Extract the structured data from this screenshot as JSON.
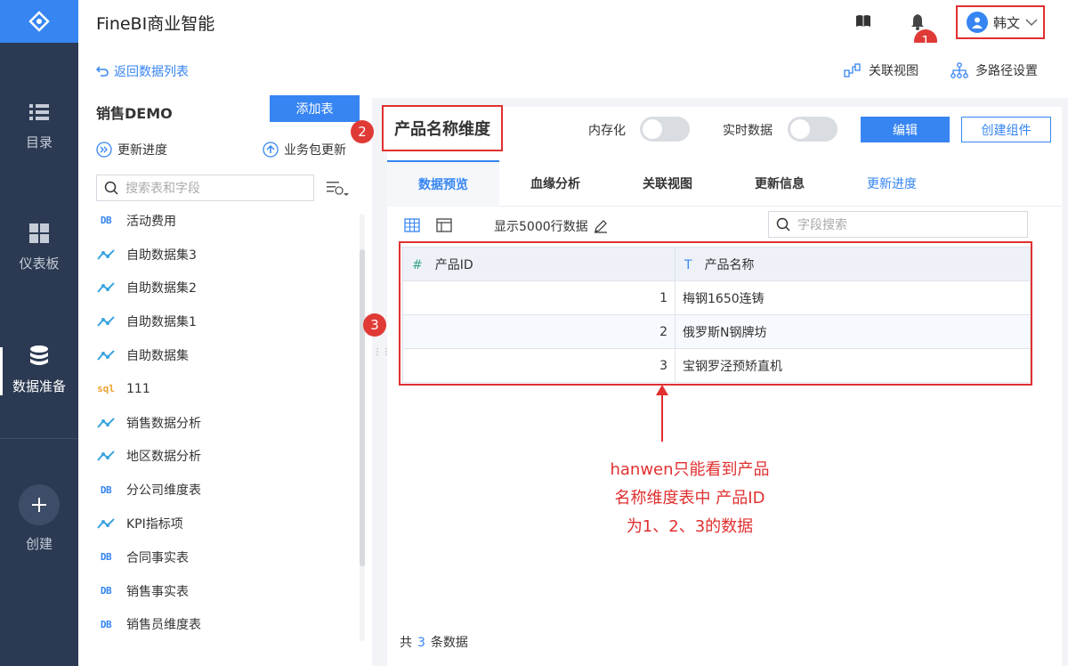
{
  "app": {
    "title": "FineBI商业智能"
  },
  "user": {
    "name": "韩文"
  },
  "nav": {
    "items": [
      {
        "label": "目录",
        "icon": "list-icon"
      },
      {
        "label": "仪表板",
        "icon": "dashboard-icon"
      },
      {
        "label": "数据准备",
        "icon": "database-icon"
      },
      {
        "label": "创建",
        "icon": "plus-icon"
      }
    ]
  },
  "left_panel": {
    "back_label": "返回数据列表",
    "db_title": "销售DEMO",
    "add_table_label": "添加表",
    "update_progress_label": "更新进度",
    "package_update_label": "业务包更新",
    "search_placeholder": "搜索表和字段",
    "tables": [
      {
        "type": "DB",
        "label": "活动费用"
      },
      {
        "type": "self",
        "label": "自助数据集3"
      },
      {
        "type": "self",
        "label": "自助数据集2"
      },
      {
        "type": "self",
        "label": "自助数据集1"
      },
      {
        "type": "self",
        "label": "自助数据集"
      },
      {
        "type": "sql",
        "label": "111"
      },
      {
        "type": "self",
        "label": "销售数据分析"
      },
      {
        "type": "self",
        "label": "地区数据分析"
      },
      {
        "type": "DB",
        "label": "分公司维度表"
      },
      {
        "type": "self",
        "label": "KPI指标项"
      },
      {
        "type": "DB",
        "label": "合同事实表"
      },
      {
        "type": "DB",
        "label": "销售事实表"
      },
      {
        "type": "DB",
        "label": "销售员维度表"
      }
    ]
  },
  "toolbar": {
    "relation_view_label": "关联视图",
    "multipath_label": "多路径设置"
  },
  "table_header": {
    "title": "产品名称维度",
    "in_memory_label": "内存化",
    "realtime_label": "实时数据",
    "edit_label": "编辑",
    "create_component_label": "创建组件"
  },
  "tabs": [
    {
      "label": "数据预览",
      "active": true
    },
    {
      "label": "血缘分析"
    },
    {
      "label": "关联视图"
    },
    {
      "label": "更新信息"
    },
    {
      "label": "更新进度",
      "link": true
    }
  ],
  "preview": {
    "rows_label": "显示5000行数据",
    "field_search_placeholder": "字段搜索",
    "columns": [
      {
        "type_icon": "#",
        "name": "产品ID"
      },
      {
        "type_icon": "T",
        "name": "产品名称"
      }
    ],
    "rows": [
      {
        "id": "1",
        "name": "梅钢1650连铸"
      },
      {
        "id": "2",
        "name": "俄罗斯N钢牌坊"
      },
      {
        "id": "3",
        "name": "宝钢罗泾预矫直机"
      }
    ],
    "footer_prefix": "共",
    "footer_count": "3",
    "footer_suffix": "条数据"
  },
  "annotations": {
    "badge1": "1",
    "badge2": "2",
    "badge3": "3",
    "note_line1": "hanwen只能看到产品",
    "note_line2": "名称维度表中 产品ID",
    "note_line3": "为1、2、3的数据"
  },
  "colors": {
    "accent": "#3685f2",
    "nav_bg": "#2b3a52",
    "annotation_red": "#e03030"
  }
}
